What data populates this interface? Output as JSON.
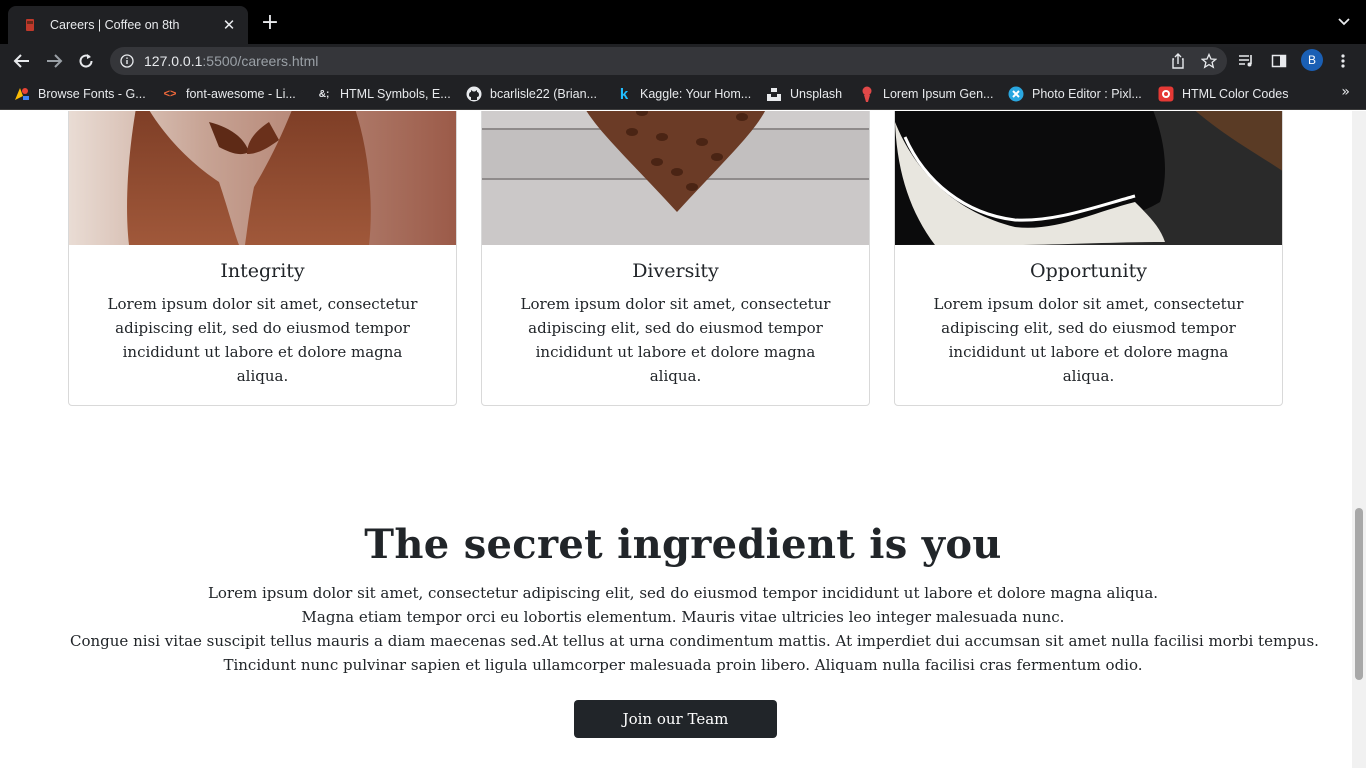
{
  "browser": {
    "tab_title": "Careers | Coffee on 8th",
    "url_host": "127.0.0.1",
    "url_rest": ":5500/careers.html",
    "profile_initial": "B",
    "bookmarks": [
      {
        "label": "Browse Fonts - G...",
        "icon": "google-fonts-icon"
      },
      {
        "label": "font-awesome - Li...",
        "icon": "code-brackets-icon"
      },
      {
        "label": "HTML Symbols, E...",
        "icon": "ampersand-icon"
      },
      {
        "label": "bcarlisle22 (Brian...",
        "icon": "github-icon"
      },
      {
        "label": "Kaggle: Your Hom...",
        "icon": "kaggle-icon"
      },
      {
        "label": "Unsplash",
        "icon": "unsplash-icon"
      },
      {
        "label": "Lorem Ipsum Gen...",
        "icon": "lorem-icon"
      },
      {
        "label": "Photo Editor : Pixl...",
        "icon": "pixlr-icon"
      },
      {
        "label": "HTML Color Codes",
        "icon": "color-codes-icon"
      }
    ]
  },
  "cards": [
    {
      "title": "Integrity",
      "text": "Lorem ipsum dolor sit amet, consectetur adipiscing elit, sed do eiusmod tempor incididunt ut labore et dolore magna aliqua."
    },
    {
      "title": "Diversity",
      "text": "Lorem ipsum dolor sit amet, consectetur adipiscing elit, sed do eiusmod tempor incididunt ut labore et dolore magna aliqua."
    },
    {
      "title": "Opportunity",
      "text": "Lorem ipsum dolor sit amet, consectetur adipiscing elit, sed do eiusmod tempor incididunt ut labore et dolore magna aliqua."
    }
  ],
  "section": {
    "title": "The secret ingredient is you",
    "lines": [
      "Lorem ipsum dolor sit amet, consectetur adipiscing elit, sed do eiusmod tempor incididunt ut labore et dolore magna aliqua.",
      "Magna etiam tempor orci eu lobortis elementum. Mauris vitae ultricies leo integer malesuada nunc.",
      "Congue nisi vitae suscipit tellus mauris a diam maecenas sed.At tellus at urna condimentum mattis. At imperdiet dui accumsan sit amet nulla facilisi morbi tempus.",
      "Tincidunt nunc pulvinar sapien et ligula ullamcorper malesuada proin libero. Aliquam nulla facilisi cras fermentum odio."
    ],
    "button_label": "Join our Team"
  },
  "colors": {
    "button_bg": "#212529",
    "chrome_bg": "#202124",
    "text": "#212529"
  }
}
